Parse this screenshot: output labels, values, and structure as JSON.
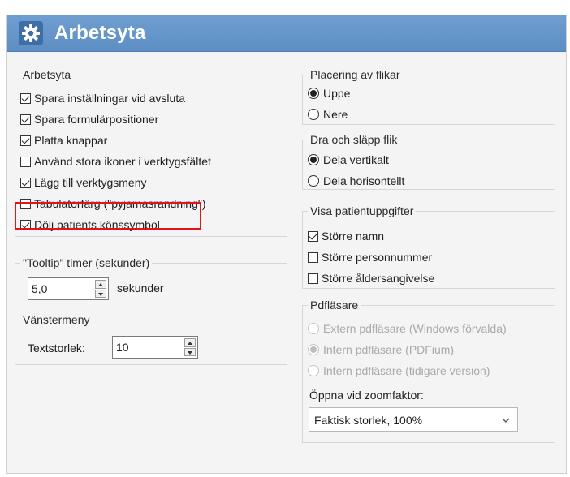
{
  "window": {
    "title": "Arbetsyta"
  },
  "workspace": {
    "label": "Arbetsyta",
    "options": [
      {
        "label": "Spara inställningar vid avsluta",
        "checked": true
      },
      {
        "label": "Spara formulärpositioner",
        "checked": true
      },
      {
        "label": "Platta knappar",
        "checked": true
      },
      {
        "label": "Använd stora ikoner i verktygsfältet",
        "checked": false
      },
      {
        "label": "Lägg till verktygsmeny",
        "checked": true
      },
      {
        "label": "Tabulatorfärg (\"pyjamasrandning\")",
        "checked": false
      },
      {
        "label": "Dölj patients könssymbol",
        "checked": true
      }
    ]
  },
  "tooltip": {
    "label": "\"Tooltip\" timer (sekunder)",
    "value": "5,0",
    "unit": "sekunder"
  },
  "left_menu": {
    "label": "Vänstermeny",
    "text_size_label": "Textstorlek:",
    "text_size_value": "10"
  },
  "tab_placement": {
    "label": "Placering av flikar",
    "options": [
      {
        "label": "Uppe",
        "selected": true
      },
      {
        "label": "Nere",
        "selected": false
      }
    ]
  },
  "drag_drop": {
    "label": "Dra och släpp flik",
    "options": [
      {
        "label": "Dela vertikalt",
        "selected": true
      },
      {
        "label": "Dela horisontellt",
        "selected": false
      }
    ]
  },
  "patient_info": {
    "label": "Visa patientuppgifter",
    "options": [
      {
        "label": "Större namn",
        "checked": true
      },
      {
        "label": "Större personnummer",
        "checked": false
      },
      {
        "label": "Större åldersangivelse",
        "checked": false
      }
    ]
  },
  "pdf": {
    "label": "Pdfläsare",
    "options": [
      {
        "label": "Extern pdfläsare (Windows förvalda)",
        "selected": false
      },
      {
        "label": "Intern pdfläsare (PDFium)",
        "selected": true
      },
      {
        "label": "Intern pdfläsare (tidigare version)",
        "selected": false
      }
    ],
    "zoom_label": "Öppna vid zoomfaktor:",
    "zoom_value": "Faktisk storlek, 100%"
  },
  "colors": {
    "title_bar": "#5d8fc4",
    "highlight": "#e0141b"
  }
}
